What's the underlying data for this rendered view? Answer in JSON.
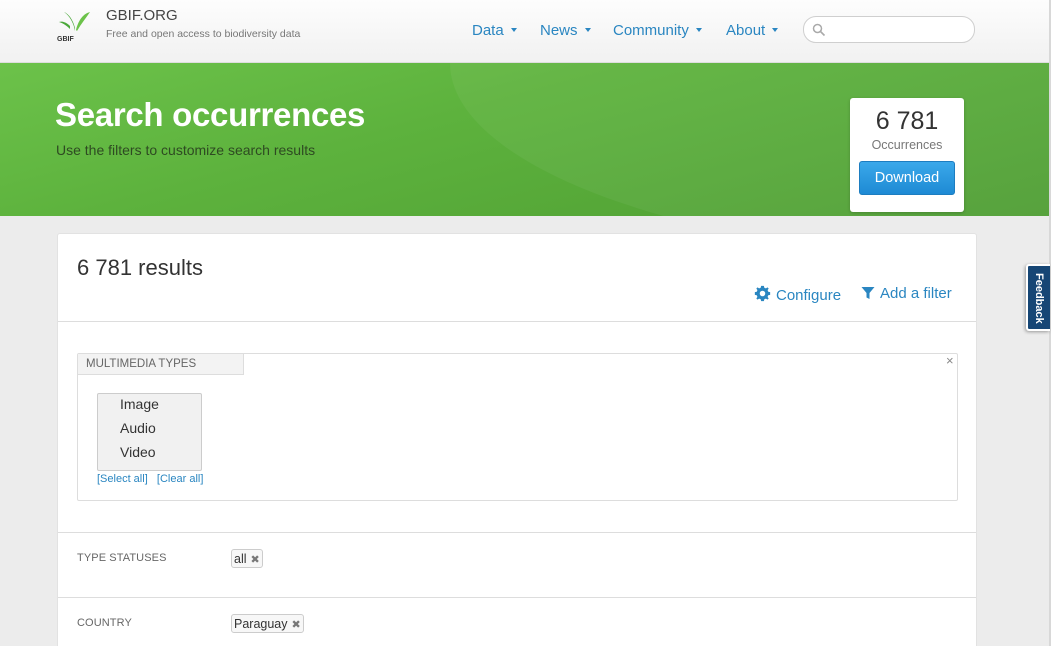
{
  "header": {
    "brand_name": "GBIF.ORG",
    "brand_tagline": "Free and open access to biodiversity data",
    "logo_text": "GBIF",
    "nav": [
      {
        "label": "Data"
      },
      {
        "label": "News"
      },
      {
        "label": "Community"
      },
      {
        "label": "About"
      }
    ],
    "search": {
      "value": "",
      "placeholder": ""
    }
  },
  "banner": {
    "title": "Search occurrences",
    "subtitle": "Use the filters to customize search results",
    "count": "6 781",
    "count_label": "Occurrences",
    "download_label": "Download"
  },
  "results": {
    "count_text": "6 781 results",
    "configure_label": "Configure",
    "add_filter_label": "Add a filter"
  },
  "multimedia": {
    "title": "MULTIMEDIA TYPES",
    "close_glyph": "×",
    "options": [
      "Image",
      "Audio",
      "Video"
    ],
    "select_all": "[Select all]",
    "clear_all": "[Clear all]"
  },
  "filters": [
    {
      "label": "TYPE STATUSES",
      "value": "all"
    },
    {
      "label": "COUNTRY",
      "value": "Paraguay"
    }
  ],
  "feedback_label": "Feedback",
  "colors": {
    "accent": "#2a86c1",
    "banner_green": "#5db23d",
    "feedback_blue": "#164675"
  }
}
